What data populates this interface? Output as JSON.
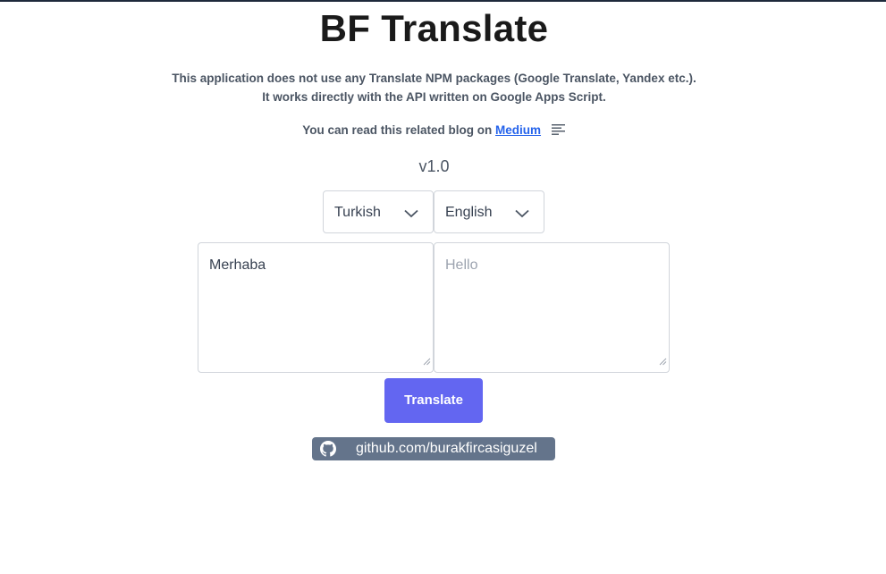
{
  "app": {
    "title": "BF Translate",
    "description_line1": "This application does not use any Translate NPM packages (Google Translate, Yandex etc.).",
    "description_line2": "It works directly with the API written on Google Apps Script.",
    "blog_prefix": "You can read this related blog on",
    "blog_link": "Medium",
    "version": "v1.0"
  },
  "languages": {
    "source": "Turkish",
    "target": "English"
  },
  "input": {
    "source_text": "Merhaba",
    "target_placeholder": "Hello"
  },
  "actions": {
    "translate_label": "Translate"
  },
  "footer": {
    "github_label": "github.com/burakfircasiguzel"
  },
  "colors": {
    "accent": "#6366f1",
    "link": "#2563eb",
    "github_badge": "#64748b"
  },
  "icons": {
    "blog": "menu-lines-icon",
    "select": "chevron-down-icon",
    "footer": "github-icon"
  }
}
